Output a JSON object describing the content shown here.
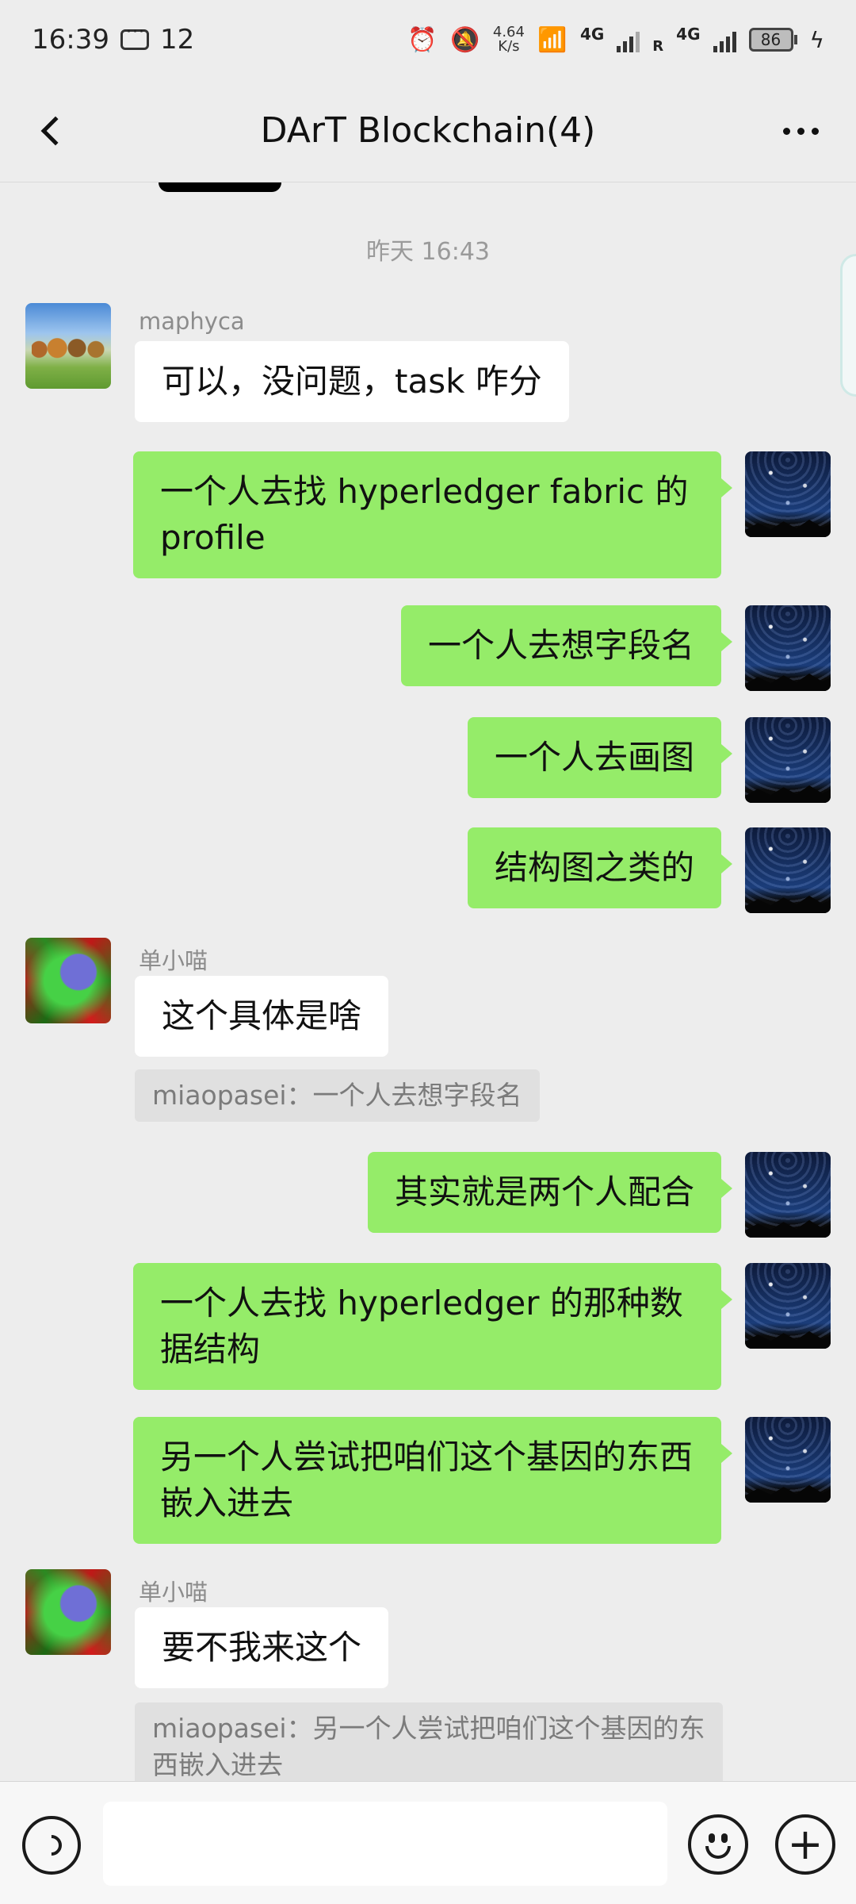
{
  "status_bar": {
    "time": "16:39",
    "notification_count": "12",
    "net_speed_value": "4.64",
    "net_speed_unit": "K/s",
    "sim1_type": "4G",
    "sim2_type": "4G",
    "sim2_roaming": "R",
    "battery": "86"
  },
  "header": {
    "title": "DArT Blockchain(4)",
    "back_icon": "chevron-left-icon",
    "more_icon": "more-horizontal-icon"
  },
  "chat": {
    "time_separator": "昨天 16:43",
    "messages": [
      {
        "sender": "maphyca",
        "text": "可以，没问题，task 咋分"
      },
      {
        "text": "一个人去找 hyperledger fabric 的 profile"
      },
      {
        "text": "一个人去想字段名"
      },
      {
        "text": "一个人去画图"
      },
      {
        "text": "结构图之类的"
      },
      {
        "sender": "单小喵",
        "text": "这个具体是啥",
        "quote": "miaopasei：一个人去想字段名"
      },
      {
        "text": "其实就是两个人配合"
      },
      {
        "text": "一个人去找 hyperledger 的那种数据结构"
      },
      {
        "text": "另一个人尝试把咱们这个基因的东西嵌入进去"
      },
      {
        "sender": "单小喵",
        "text": "要不我来这个",
        "quote": "miaopasei：另一个人尝试把咱们这个基因的东西嵌入进去"
      }
    ]
  },
  "input_bar": {
    "voice_icon": "voice-icon",
    "emoji_icon": "emoji-icon",
    "plus_label": "+"
  },
  "colors": {
    "background": "#ededed",
    "self_bubble": "#95ec69",
    "other_bubble": "#ffffff",
    "quote_bg": "#e0e0e0"
  }
}
